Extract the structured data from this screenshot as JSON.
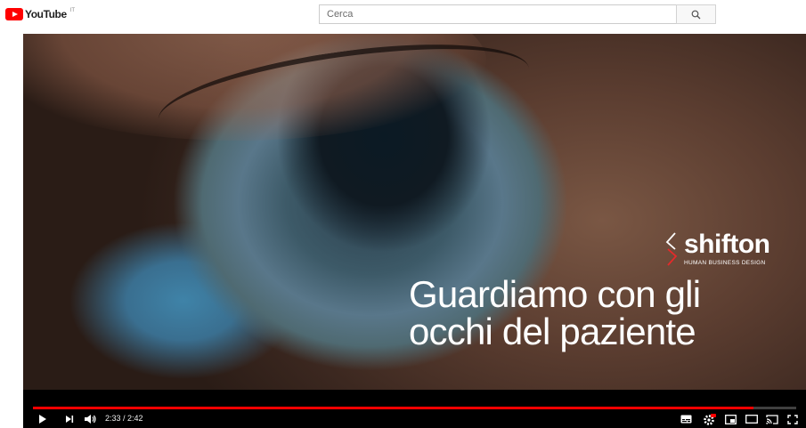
{
  "header": {
    "logo_text": "YouTube",
    "logo_region": "IT",
    "search": {
      "placeholder": "Cerca"
    }
  },
  "video": {
    "overlay": {
      "brand_name": "shifton",
      "brand_tagline": "HUMAN BUSINESS DESIGN",
      "headline_line1": "Guardiamo con gli",
      "headline_line2": "occhi del paziente"
    },
    "player": {
      "current_time": "2:33",
      "duration": "2:42",
      "time_display": "2:33 / 2:42",
      "progress_fraction": 0.944
    }
  },
  "colors": {
    "brand_red": "#ff0000",
    "progress_played": "#ff0000",
    "controls_bg": "#000000"
  },
  "icons": {
    "play": "play-icon",
    "next": "next-icon",
    "volume": "volume-icon",
    "subtitles": "subtitles-icon",
    "settings": "settings-icon",
    "miniplayer": "miniplayer-icon",
    "theater": "theater-mode-icon",
    "cast": "cast-icon",
    "fullscreen": "fullscreen-icon",
    "search": "search-icon"
  }
}
